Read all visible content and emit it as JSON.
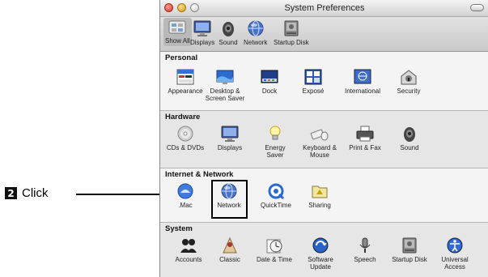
{
  "window": {
    "title": "System Preferences"
  },
  "toolbar": {
    "items": [
      {
        "label": "Show All",
        "icon": "apple-switch-icon"
      },
      {
        "label": "Displays",
        "icon": "display-icon"
      },
      {
        "label": "Sound",
        "icon": "speaker-icon"
      },
      {
        "label": "Network",
        "icon": "globe-icon"
      },
      {
        "label": "Startup Disk",
        "icon": "hard-disk-icon"
      }
    ]
  },
  "sections": {
    "personal": {
      "title": "Personal",
      "items": [
        {
          "label": "Appearance",
          "icon": "appearance-icon"
        },
        {
          "label": "Desktop &\nScreen Saver",
          "icon": "desktop-icon"
        },
        {
          "label": "Dock",
          "icon": "dock-icon"
        },
        {
          "label": "Exposé",
          "icon": "expose-icon"
        },
        {
          "label": "International",
          "icon": "flag-icon"
        },
        {
          "label": "Security",
          "icon": "lock-house-icon"
        }
      ]
    },
    "hardware": {
      "title": "Hardware",
      "items": [
        {
          "label": "CDs & DVDs",
          "icon": "cd-icon"
        },
        {
          "label": "Displays",
          "icon": "display-icon"
        },
        {
          "label": "Energy\nSaver",
          "icon": "lightbulb-icon"
        },
        {
          "label": "Keyboard &\nMouse",
          "icon": "keyboard-mouse-icon"
        },
        {
          "label": "Print & Fax",
          "icon": "printer-icon"
        },
        {
          "label": "Sound",
          "icon": "speaker-icon"
        }
      ]
    },
    "internet": {
      "title": "Internet & Network",
      "items": [
        {
          "label": ".Mac",
          "icon": "dotmac-icon"
        },
        {
          "label": "Network",
          "icon": "globe-icon"
        },
        {
          "label": "QuickTime",
          "icon": "quicktime-icon"
        },
        {
          "label": "Sharing",
          "icon": "sharing-folder-icon"
        }
      ]
    },
    "system": {
      "title": "System",
      "items": [
        {
          "label": "Accounts",
          "icon": "accounts-icon"
        },
        {
          "label": "Classic",
          "icon": "classic-icon"
        },
        {
          "label": "Date & Time",
          "icon": "clock-icon"
        },
        {
          "label": "Software\nUpdate",
          "icon": "software-update-icon"
        },
        {
          "label": "Speech",
          "icon": "microphone-icon"
        },
        {
          "label": "Startup Disk",
          "icon": "hard-disk-icon"
        },
        {
          "label": "Universal\nAccess",
          "icon": "universal-access-icon"
        }
      ]
    }
  },
  "callout": {
    "step": "2",
    "label": "Click"
  },
  "colors": {
    "highlight": "#000000",
    "network_blue": "#3f6fd0"
  }
}
